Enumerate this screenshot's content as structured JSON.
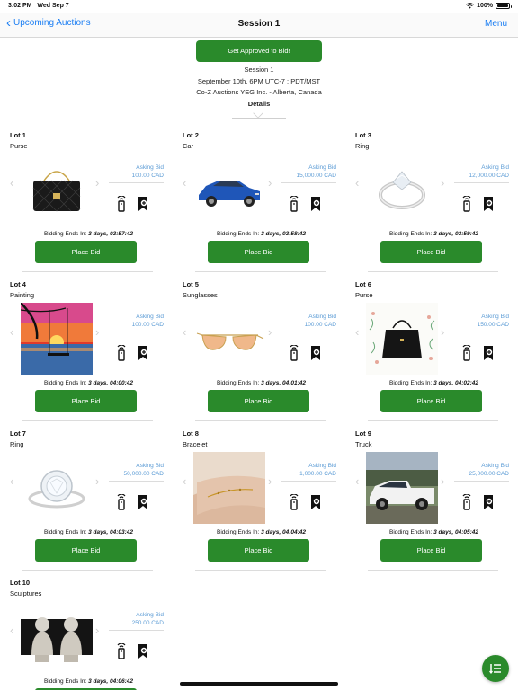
{
  "status_bar": {
    "time": "3:02 PM",
    "date": "Wed Sep 7",
    "battery": "100%"
  },
  "nav": {
    "back_label": "Upcoming Auctions",
    "title": "Session 1",
    "menu_label": "Menu"
  },
  "session": {
    "approve_label": "Get Approved to Bid!",
    "name": "Session 1",
    "schedule": "September 10th, 6PM UTC-7 : PDT/MST",
    "company": "Co-Z Auctions YEG Inc. - Alberta, Canada",
    "details_label": "Details"
  },
  "lot_ui": {
    "asking_label": "Asking Bid",
    "bidding_label": "Bidding Ends In:",
    "place_bid_label": "Place Bid",
    "prev_arrow": "‹",
    "next_arrow": "›"
  },
  "lots": [
    {
      "number": "Lot 1",
      "title": "Purse",
      "asking_bid": "100.00 CAD",
      "ends_in": "3 days, 03:57:42",
      "image": "black-quilted-purse"
    },
    {
      "number": "Lot 2",
      "title": "Car",
      "asking_bid": "15,000.00 CAD",
      "ends_in": "3 days, 03:58:42",
      "image": "blue-sedan"
    },
    {
      "number": "Lot 3",
      "title": "Ring",
      "asking_bid": "12,000.00 CAD",
      "ends_in": "3 days, 03:59:42",
      "image": "diamond-ring"
    },
    {
      "number": "Lot 4",
      "title": "Painting",
      "asking_bid": "100.00 CAD",
      "ends_in": "3 days, 04:00:42",
      "image": "sunset-painting"
    },
    {
      "number": "Lot 5",
      "title": "Sunglasses",
      "asking_bid": "100.00 CAD",
      "ends_in": "3 days, 04:01:42",
      "image": "aviator-sunglasses"
    },
    {
      "number": "Lot 6",
      "title": "Purse",
      "asking_bid": "150.00 CAD",
      "ends_in": "3 days, 04:02:42",
      "image": "black-tote-bag"
    },
    {
      "number": "Lot 7",
      "title": "Ring",
      "asking_bid": "50,000.00 CAD",
      "ends_in": "3 days, 04:03:42",
      "image": "halo-diamond-ring"
    },
    {
      "number": "Lot 8",
      "title": "Bracelet",
      "asking_bid": "1,000.00 CAD",
      "ends_in": "3 days, 04:04:42",
      "image": "gold-bracelet"
    },
    {
      "number": "Lot 9",
      "title": "Truck",
      "asking_bid": "25,000.00 CAD",
      "ends_in": "3 days, 04:05:42",
      "image": "white-pickup-truck"
    },
    {
      "number": "Lot 10",
      "title": "Sculptures",
      "asking_bid": "250.00 CAD",
      "ends_in": "3 days, 04:06:42",
      "image": "marble-busts"
    }
  ],
  "colors": {
    "accent_blue": "#1d7ff3",
    "bid_green": "#2a8a2b",
    "asking_blue": "#5b9bd5"
  }
}
